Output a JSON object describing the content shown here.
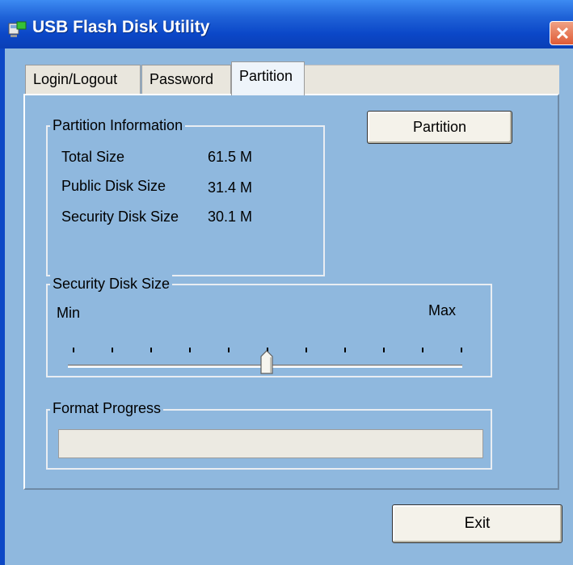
{
  "window": {
    "title": "USB Flash Disk Utility",
    "close_glyph": "✕"
  },
  "tabs": [
    {
      "label": "Login/Logout",
      "active": false
    },
    {
      "label": "Password",
      "active": false
    },
    {
      "label": "Partition",
      "active": true
    }
  ],
  "partition_info": {
    "group_label": "Partition Information",
    "rows": [
      {
        "label": "Total Size",
        "value": "61.5 M"
      },
      {
        "label": "Public Disk Size",
        "value": "31.4 M"
      },
      {
        "label": "Security Disk Size",
        "value": "30.1 M"
      }
    ]
  },
  "partition_button": {
    "label": "Partition"
  },
  "security_slider": {
    "group_label": "Security Disk Size",
    "min_label": "Min",
    "max_label": "Max",
    "tick_count": 11,
    "value_fraction": 0.5
  },
  "format_progress": {
    "group_label": "Format Progress",
    "fraction": 0
  },
  "exit_button": {
    "label": "Exit"
  },
  "colors": {
    "panel_bg": "#8fb8de",
    "titlebar": "#0b47c8",
    "close": "#df5a35"
  },
  "icons": [
    "app-icon",
    "close-icon"
  ]
}
